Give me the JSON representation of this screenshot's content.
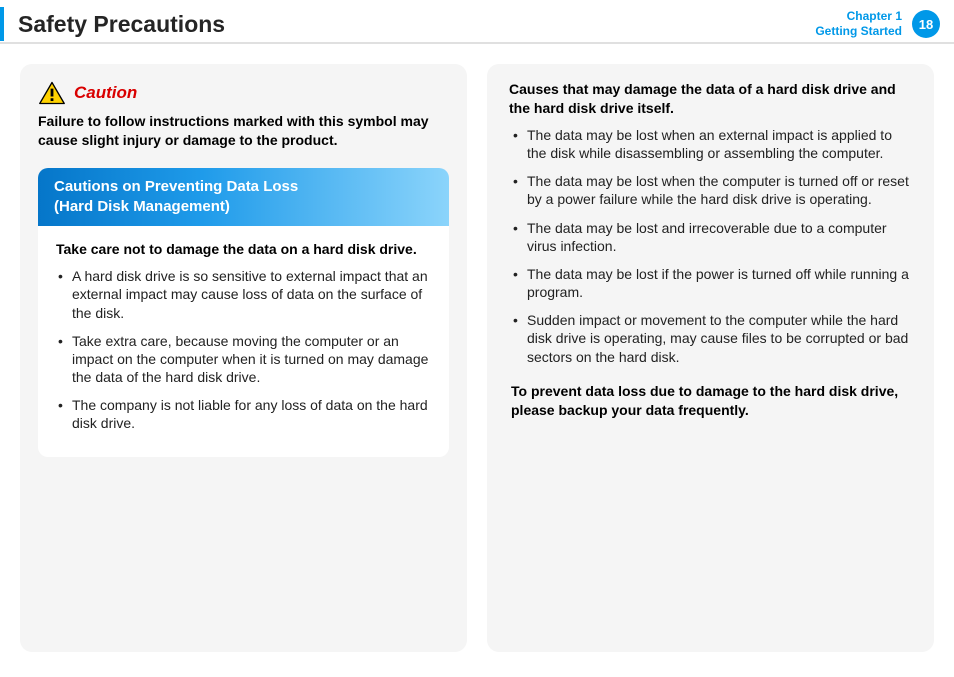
{
  "header": {
    "title": "Safety Precautions",
    "chapter_line1": "Chapter 1",
    "chapter_line2": "Getting Started",
    "page_number": "18"
  },
  "left": {
    "caution_label": "Caution",
    "caution_desc": "Failure to follow instructions marked with this symbol may cause slight injury or damage to the product.",
    "box_header_line1": "Cautions on Preventing Data Loss",
    "box_header_line2": "(Hard Disk Management)",
    "sub_head": "Take care not to damage the data on a hard disk drive.",
    "bullets": [
      "A hard disk drive is so sensitive to external impact that an external impact may cause loss of data on the surface of the disk.",
      "Take extra care, because moving the computer or an impact on the computer when it is turned on may damage the data of the hard disk drive.",
      "The company is not liable for any loss of data on the hard disk drive."
    ]
  },
  "right": {
    "sub_head": "Causes that may damage the data of a hard disk drive and the hard disk drive itself.",
    "bullets": [
      "The data may be lost when an external impact is applied to the disk while disassembling or assembling the computer.",
      "The data may be lost when the computer is turned off or reset by a power failure while the hard disk drive is operating.",
      "The data may be lost and irrecoverable due to a computer virus infection.",
      "The data may be lost if the power is turned off while running a program.",
      "Sudden impact or movement to the computer while the hard disk drive is operating, may cause files to be corrupted or bad sectors on the hard disk."
    ],
    "final_note": "To prevent data loss due to damage to the hard disk drive, please backup your data frequently."
  }
}
